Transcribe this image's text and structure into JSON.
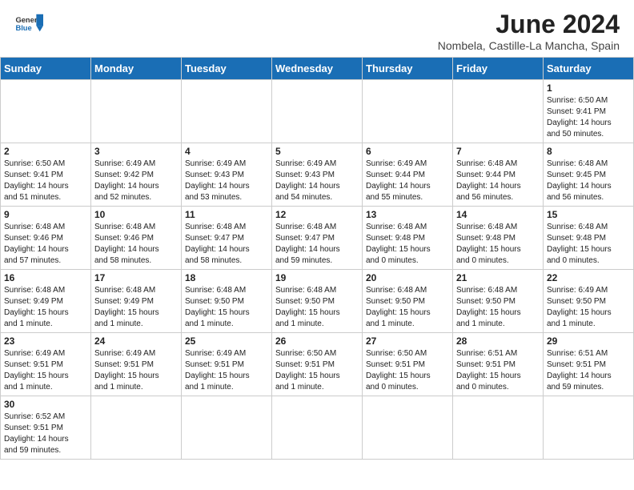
{
  "header": {
    "title": "June 2024",
    "location": "Nombela, Castille-La Mancha, Spain",
    "logo_general": "General",
    "logo_blue": "Blue"
  },
  "days_of_week": [
    "Sunday",
    "Monday",
    "Tuesday",
    "Wednesday",
    "Thursday",
    "Friday",
    "Saturday"
  ],
  "weeks": [
    [
      {
        "day": "",
        "info": ""
      },
      {
        "day": "",
        "info": ""
      },
      {
        "day": "",
        "info": ""
      },
      {
        "day": "",
        "info": ""
      },
      {
        "day": "",
        "info": ""
      },
      {
        "day": "",
        "info": ""
      },
      {
        "day": "1",
        "info": "Sunrise: 6:50 AM\nSunset: 9:41 PM\nDaylight: 14 hours\nand 50 minutes."
      }
    ],
    [
      {
        "day": "2",
        "info": "Sunrise: 6:50 AM\nSunset: 9:41 PM\nDaylight: 14 hours\nand 51 minutes."
      },
      {
        "day": "3",
        "info": "Sunrise: 6:49 AM\nSunset: 9:42 PM\nDaylight: 14 hours\nand 52 minutes."
      },
      {
        "day": "4",
        "info": "Sunrise: 6:49 AM\nSunset: 9:43 PM\nDaylight: 14 hours\nand 53 minutes."
      },
      {
        "day": "5",
        "info": "Sunrise: 6:49 AM\nSunset: 9:43 PM\nDaylight: 14 hours\nand 54 minutes."
      },
      {
        "day": "6",
        "info": "Sunrise: 6:49 AM\nSunset: 9:44 PM\nDaylight: 14 hours\nand 55 minutes."
      },
      {
        "day": "7",
        "info": "Sunrise: 6:48 AM\nSunset: 9:44 PM\nDaylight: 14 hours\nand 56 minutes."
      },
      {
        "day": "8",
        "info": "Sunrise: 6:48 AM\nSunset: 9:45 PM\nDaylight: 14 hours\nand 56 minutes."
      }
    ],
    [
      {
        "day": "9",
        "info": "Sunrise: 6:48 AM\nSunset: 9:46 PM\nDaylight: 14 hours\nand 57 minutes."
      },
      {
        "day": "10",
        "info": "Sunrise: 6:48 AM\nSunset: 9:46 PM\nDaylight: 14 hours\nand 58 minutes."
      },
      {
        "day": "11",
        "info": "Sunrise: 6:48 AM\nSunset: 9:47 PM\nDaylight: 14 hours\nand 58 minutes."
      },
      {
        "day": "12",
        "info": "Sunrise: 6:48 AM\nSunset: 9:47 PM\nDaylight: 14 hours\nand 59 minutes."
      },
      {
        "day": "13",
        "info": "Sunrise: 6:48 AM\nSunset: 9:48 PM\nDaylight: 15 hours\nand 0 minutes."
      },
      {
        "day": "14",
        "info": "Sunrise: 6:48 AM\nSunset: 9:48 PM\nDaylight: 15 hours\nand 0 minutes."
      },
      {
        "day": "15",
        "info": "Sunrise: 6:48 AM\nSunset: 9:48 PM\nDaylight: 15 hours\nand 0 minutes."
      }
    ],
    [
      {
        "day": "16",
        "info": "Sunrise: 6:48 AM\nSunset: 9:49 PM\nDaylight: 15 hours\nand 1 minute."
      },
      {
        "day": "17",
        "info": "Sunrise: 6:48 AM\nSunset: 9:49 PM\nDaylight: 15 hours\nand 1 minute."
      },
      {
        "day": "18",
        "info": "Sunrise: 6:48 AM\nSunset: 9:50 PM\nDaylight: 15 hours\nand 1 minute."
      },
      {
        "day": "19",
        "info": "Sunrise: 6:48 AM\nSunset: 9:50 PM\nDaylight: 15 hours\nand 1 minute."
      },
      {
        "day": "20",
        "info": "Sunrise: 6:48 AM\nSunset: 9:50 PM\nDaylight: 15 hours\nand 1 minute."
      },
      {
        "day": "21",
        "info": "Sunrise: 6:48 AM\nSunset: 9:50 PM\nDaylight: 15 hours\nand 1 minute."
      },
      {
        "day": "22",
        "info": "Sunrise: 6:49 AM\nSunset: 9:50 PM\nDaylight: 15 hours\nand 1 minute."
      }
    ],
    [
      {
        "day": "23",
        "info": "Sunrise: 6:49 AM\nSunset: 9:51 PM\nDaylight: 15 hours\nand 1 minute."
      },
      {
        "day": "24",
        "info": "Sunrise: 6:49 AM\nSunset: 9:51 PM\nDaylight: 15 hours\nand 1 minute."
      },
      {
        "day": "25",
        "info": "Sunrise: 6:49 AM\nSunset: 9:51 PM\nDaylight: 15 hours\nand 1 minute."
      },
      {
        "day": "26",
        "info": "Sunrise: 6:50 AM\nSunset: 9:51 PM\nDaylight: 15 hours\nand 1 minute."
      },
      {
        "day": "27",
        "info": "Sunrise: 6:50 AM\nSunset: 9:51 PM\nDaylight: 15 hours\nand 0 minutes."
      },
      {
        "day": "28",
        "info": "Sunrise: 6:51 AM\nSunset: 9:51 PM\nDaylight: 15 hours\nand 0 minutes."
      },
      {
        "day": "29",
        "info": "Sunrise: 6:51 AM\nSunset: 9:51 PM\nDaylight: 14 hours\nand 59 minutes."
      }
    ],
    [
      {
        "day": "30",
        "info": "Sunrise: 6:52 AM\nSunset: 9:51 PM\nDaylight: 14 hours\nand 59 minutes."
      },
      {
        "day": "",
        "info": ""
      },
      {
        "day": "",
        "info": ""
      },
      {
        "day": "",
        "info": ""
      },
      {
        "day": "",
        "info": ""
      },
      {
        "day": "",
        "info": ""
      },
      {
        "day": "",
        "info": ""
      }
    ]
  ]
}
